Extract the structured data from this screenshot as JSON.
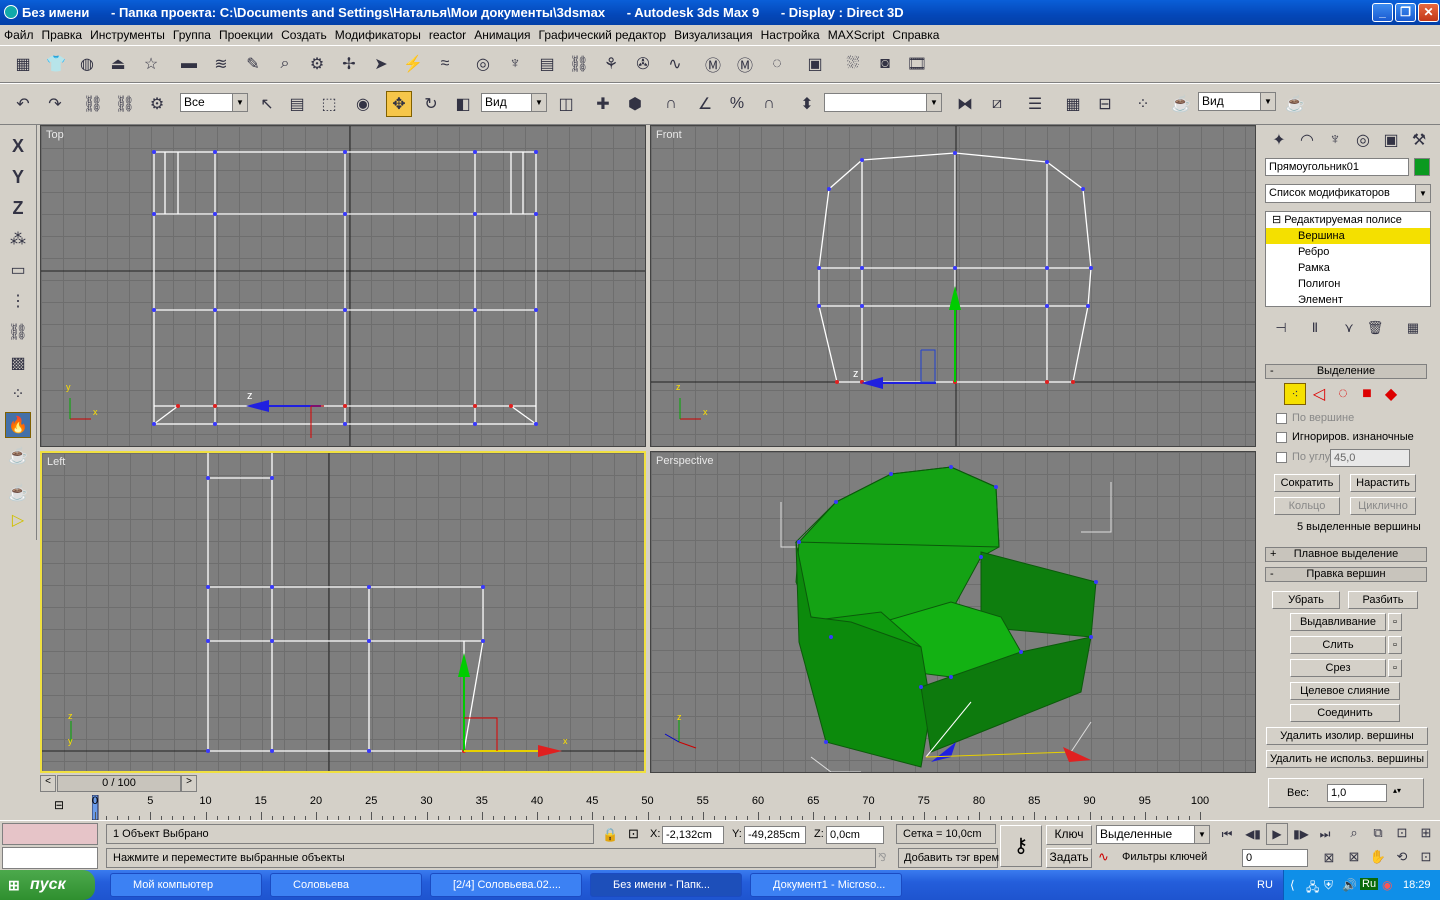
{
  "window": {
    "title": "Без имени      - Папка проекта: C:\\Documents and Settings\\Наталья\\Мои документы\\3dsmax      - Autodesk 3ds Max 9      - Display : Direct 3D"
  },
  "menu": [
    "Файл",
    "Правка",
    "Инструменты",
    "Группа",
    "Проекции",
    "Создать",
    "Модификаторы",
    "reactor",
    "Анимация",
    "Графический редактор",
    "Визуализация",
    "Настройка",
    "MAXScript",
    "Справка"
  ],
  "main_toolbar": {
    "selection_filter": "Все",
    "ref_coord": "Вид",
    "named_selection": "",
    "render_coord": "Вид"
  },
  "left_toolbar": [
    "X",
    "Y",
    "Z"
  ],
  "viewports": {
    "top": "Top",
    "front": "Front",
    "left": "Left",
    "perspective": "Perspective"
  },
  "command_panel": {
    "object_name": "Прямоугольник01",
    "object_color": "#0a9a20",
    "modifier_list": "Список модификаторов",
    "stack": [
      "Редактируемая полисе",
      "Вершина",
      "Ребро",
      "Рамка",
      "Полигон",
      "Элемент"
    ],
    "selection_rollout": "Выделение",
    "by_vertex": "По вершине",
    "ignore_backfacing": "Игнориров. изнаночные",
    "by_angle": "По углу:",
    "angle_value": "45,0",
    "shrink": "Сократить",
    "grow": "Нарастить",
    "ring": "Кольцо",
    "loop": "Циклично",
    "selected_count": "5 выделенные вершины",
    "soft_selection": "Плавное выделение",
    "edit_vertices": "Правка вершин",
    "remove": "Убрать",
    "break": "Разбить",
    "extrude": "Выдавливание",
    "weld": "Слить",
    "chamfer": "Срез",
    "target_weld": "Целевое слияние",
    "connect": "Соединить",
    "remove_isolated": "Удалить изолир. вершины",
    "remove_unused": "Удалить не использ. вершины",
    "weight_label": "Вес:",
    "weight_value": "1,0"
  },
  "time": {
    "slider": "0 / 100",
    "ticks": [
      "0",
      "5",
      "10",
      "15",
      "20",
      "25",
      "30",
      "35",
      "40",
      "45",
      "50",
      "55",
      "60",
      "65",
      "70",
      "75",
      "80",
      "85",
      "90",
      "95",
      "100"
    ]
  },
  "status": {
    "selected": "1 Объект Выбрано",
    "prompt": "Нажмите и переместите выбранные объекты",
    "x_label": "X:",
    "x": "-2,132cm",
    "y_label": "Y:",
    "y": "-49,285cm",
    "z_label": "Z:",
    "z": "0,0cm",
    "grid": "Сетка = 10,0cm",
    "add_tag": "Добавить тэг врем",
    "key": "Ключ",
    "set": "Задать",
    "key_mode": "Выделенные",
    "key_filters": "Фильтры ключей",
    "frame": "0"
  },
  "taskbar": {
    "start": "пуск",
    "tasks": [
      "Мой компьютер",
      "Соловьева",
      "[2/4] Соловьева.02....",
      "Без имени      - Папк...",
      "Документ1 - Microso..."
    ],
    "lang": "RU",
    "clock": "18:29"
  }
}
